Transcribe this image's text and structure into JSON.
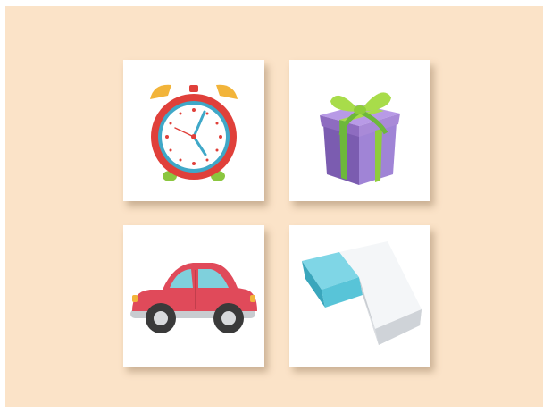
{
  "board": {
    "background_color": "#fbe3c8",
    "cards": [
      {
        "picture": "alarm-clock-icon",
        "colors": {
          "body": "#e0403a",
          "bells": "#f2b43a",
          "face": "#ffffff",
          "hands": "#3fa8c8"
        }
      },
      {
        "picture": "gift-box-icon",
        "colors": {
          "box": "#8e6cc0",
          "ribbon": "#8fcd3a"
        }
      },
      {
        "picture": "car-icon",
        "colors": {
          "body": "#e04a5a",
          "windows": "#7fd0dc",
          "wheels": "#3a3a3a"
        }
      },
      {
        "picture": "eraser-icon",
        "colors": {
          "sleeve": "#58c4d8",
          "rubber": "#eef0f2"
        }
      }
    ]
  }
}
